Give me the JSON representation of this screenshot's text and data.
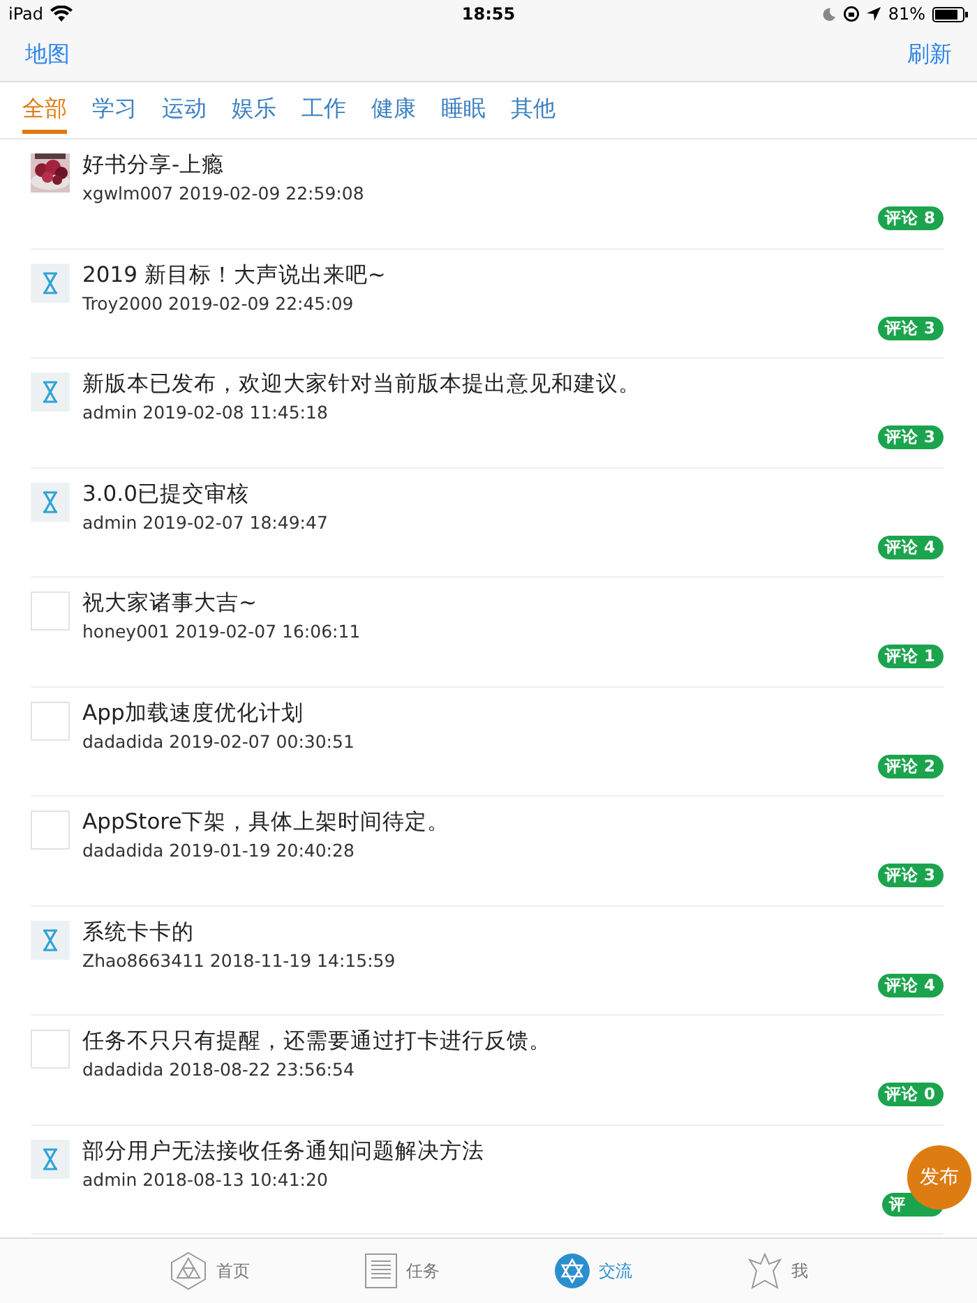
{
  "status_bar": {
    "device": "iPad",
    "time": "18:55",
    "battery": "81%"
  },
  "nav_bar": {
    "left": "地图",
    "right": "刷新"
  },
  "tabs": [
    {
      "label": "全部",
      "selected": true
    },
    {
      "label": "学习",
      "selected": false
    },
    {
      "label": "运动",
      "selected": false
    },
    {
      "label": "娱乐",
      "selected": false
    },
    {
      "label": "工作",
      "selected": false
    },
    {
      "label": "健康",
      "selected": false
    },
    {
      "label": "睡眠",
      "selected": false
    },
    {
      "label": "其他",
      "selected": false
    }
  ],
  "posts": [
    {
      "kind": "picture",
      "title": "好书分享-上瘾",
      "meta": "xgwlm007 2019-02-09 22:59:08",
      "comments": "评论 8"
    },
    {
      "kind": "hourglass",
      "title": "2019 新目标！大声说出来吧~",
      "meta": "Troy2000 2019-02-09 22:45:09",
      "comments": "评论 3"
    },
    {
      "kind": "hourglass",
      "title": "新版本已发布，欢迎大家针对当前版本提出意见和建议。",
      "meta": "admin 2019-02-08 11:45:18",
      "comments": "评论 3"
    },
    {
      "kind": "hourglass",
      "title": "3.0.0已提交审核",
      "meta": "admin 2019-02-07 18:49:47",
      "comments": "评论 4"
    },
    {
      "kind": "blank",
      "title": "祝大家诸事大吉~",
      "meta": "honey001 2019-02-07 16:06:11",
      "comments": "评论 1"
    },
    {
      "kind": "blank",
      "title": "App加载速度优化计划",
      "meta": "dadadida 2019-02-07 00:30:51",
      "comments": "评论 2"
    },
    {
      "kind": "blank",
      "title": "AppStore下架，具体上架时间待定。",
      "meta": "dadadida 2019-01-19 20:40:28",
      "comments": "评论 3"
    },
    {
      "kind": "hourglass",
      "title": "系统卡卡的",
      "meta": "Zhao8663411 2018-11-19 14:15:59",
      "comments": "评论 4"
    },
    {
      "kind": "blank",
      "title": "任务不只只有提醒，还需要通过打卡进行反馈。",
      "meta": "dadadida 2018-08-22 23:56:54",
      "comments": "评论 0"
    },
    {
      "kind": "hourglass",
      "title": "部分用户无法接收任务通知问题解决方法",
      "meta": "admin 2018-08-13 10:41:20",
      "comments": "评"
    }
  ],
  "fab": "发布",
  "tab_bar": [
    {
      "kind": "home",
      "label": "首页",
      "selected": false
    },
    {
      "kind": "tasks",
      "label": "任务",
      "selected": false
    },
    {
      "kind": "community",
      "label": "交流",
      "selected": true
    },
    {
      "kind": "me",
      "label": "我",
      "selected": false
    }
  ]
}
